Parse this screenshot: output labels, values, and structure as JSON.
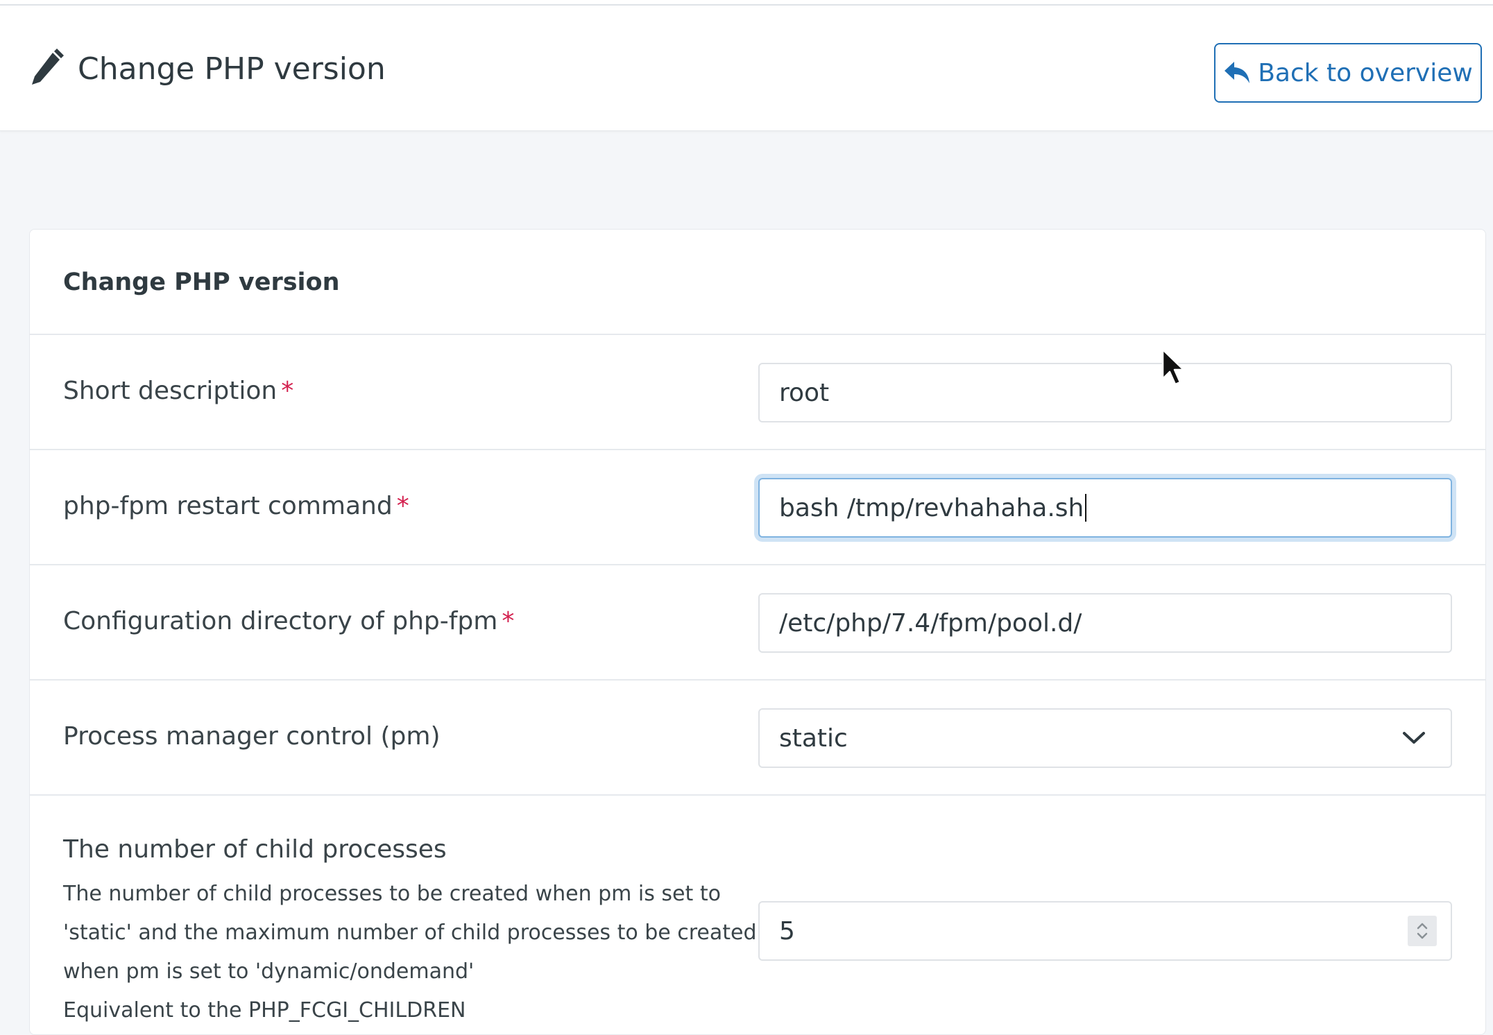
{
  "header": {
    "title": "Change PHP version",
    "title_icon": "pencil-icon",
    "back_button_label": "Back to overview",
    "back_button_icon": "reply-arrow-icon"
  },
  "card": {
    "title": "Change PHP version"
  },
  "form": {
    "short_description": {
      "label": "Short description",
      "required_marker": "*",
      "value": "root"
    },
    "restart_command": {
      "label": "php-fpm restart command",
      "required_marker": "*",
      "value": "bash /tmp/revhahaha.sh"
    },
    "config_directory": {
      "label": "Configuration directory of php-fpm",
      "required_marker": "*",
      "value": "/etc/php/7.4/fpm/pool.d/"
    },
    "pm_control": {
      "label": "Process manager control (pm)",
      "selected": "static",
      "icon": "chevron-down-icon"
    },
    "child_processes": {
      "label": "The number of child processes",
      "description_lines": [
        "The number of child processes to be created when pm is set to",
        "'static' and the maximum number of child processes to be created",
        "when pm is set to 'dynamic/ondemand'",
        "Equivalent to the PHP_FCGI_CHILDREN"
      ],
      "value": "5"
    }
  },
  "colors": {
    "accent": "#1f6fb5",
    "required": "#d3214f",
    "page_bg": "#f4f6f9",
    "focus_ring": "#cfe3f5"
  }
}
